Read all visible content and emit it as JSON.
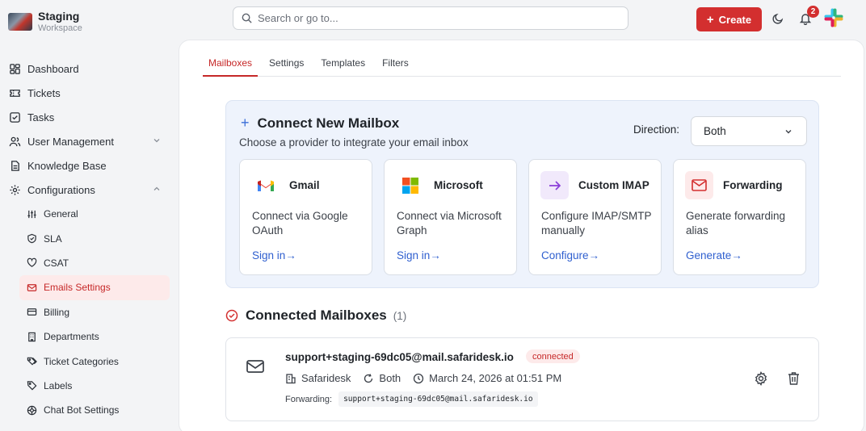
{
  "workspace": {
    "title": "Staging",
    "subtitle": "Workspace"
  },
  "search": {
    "placeholder": "Search or go to..."
  },
  "topbar": {
    "create_label": "Create",
    "notification_count": "2"
  },
  "sidebar": {
    "items": [
      {
        "label": "Dashboard",
        "icon": "dashboard-icon"
      },
      {
        "label": "Tickets",
        "icon": "ticket-icon"
      },
      {
        "label": "Tasks",
        "icon": "tasks-icon"
      },
      {
        "label": "User Management",
        "icon": "users-icon",
        "expandable": true
      },
      {
        "label": "Knowledge Base",
        "icon": "book-icon"
      },
      {
        "label": "Configurations",
        "icon": "gear-icon",
        "expanded": true
      }
    ],
    "sub_items": [
      {
        "label": "General",
        "icon": "sliders-icon"
      },
      {
        "label": "SLA",
        "icon": "shield-icon"
      },
      {
        "label": "CSAT",
        "icon": "heart-icon"
      },
      {
        "label": "Emails Settings",
        "icon": "mail-icon",
        "active": true
      },
      {
        "label": "Billing",
        "icon": "card-icon"
      },
      {
        "label": "Departments",
        "icon": "building-icon"
      },
      {
        "label": "Ticket Categories",
        "icon": "tags-icon"
      },
      {
        "label": "Labels",
        "icon": "tag-icon"
      },
      {
        "label": "Chat Bot Settings",
        "icon": "bot-icon"
      }
    ]
  },
  "tabs": [
    {
      "label": "Mailboxes",
      "active": true
    },
    {
      "label": "Settings"
    },
    {
      "label": "Templates"
    },
    {
      "label": "Filters"
    }
  ],
  "connect": {
    "title": "Connect New Mailbox",
    "subtitle": "Choose a provider to integrate your email inbox",
    "direction_label": "Direction:",
    "direction_value": "Both",
    "providers": [
      {
        "name": "Gmail",
        "desc": "Connect via Google OAuth",
        "link": "Sign in→",
        "icon": "gmail-icon"
      },
      {
        "name": "Microsoft",
        "desc": "Connect via Microsoft Graph",
        "link": "Sign in→",
        "icon": "microsoft-icon"
      },
      {
        "name": "Custom IMAP",
        "desc": "Configure IMAP/SMTP manually",
        "link": "Configure→",
        "icon": "arrow-right-icon"
      },
      {
        "name": "Forwarding",
        "desc": "Generate forwarding alias",
        "link": "Generate→",
        "icon": "mail-icon"
      }
    ]
  },
  "connected": {
    "title": "Connected Mailboxes",
    "count": "(1)",
    "mailbox": {
      "email": "support+staging-69dc05@mail.safaridesk.io",
      "status": "connected",
      "department": "Safaridesk",
      "direction": "Both",
      "date": "March 24, 2026 at 01:51 PM",
      "forwarding_label": "Forwarding:",
      "forwarding_address": "support+staging-69dc05@mail.safaridesk.io"
    }
  },
  "colors": {
    "accent": "#d32f2f",
    "link": "#2f5fcf",
    "panel": "#eef3fc"
  }
}
